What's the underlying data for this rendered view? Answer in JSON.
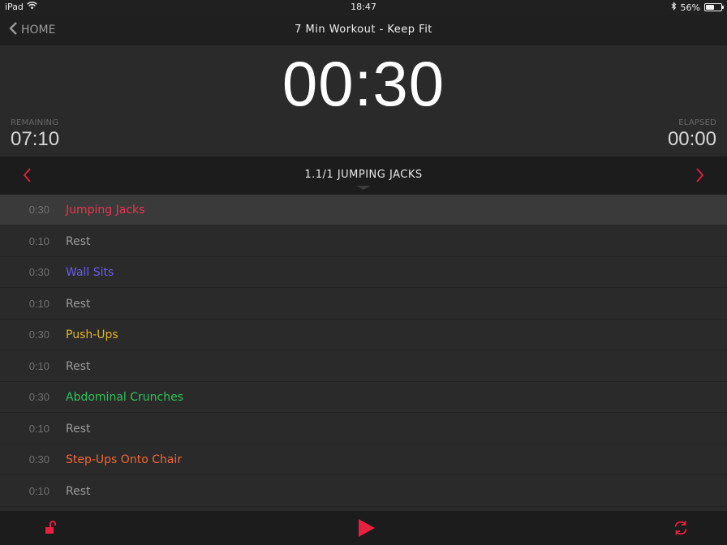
{
  "status_bar": {
    "device": "iPad",
    "time": "18:47",
    "battery_percent": "56%",
    "battery_level": 0.56
  },
  "nav": {
    "back_label": "HOME",
    "title": "7 Min Workout - Keep Fit"
  },
  "timer": {
    "current": "00:30",
    "remaining_label": "REMAINING",
    "remaining_value": "07:10",
    "elapsed_label": "ELAPSED",
    "elapsed_value": "00:00"
  },
  "current_exercise": {
    "title": "1.1/1 JUMPING JACKS"
  },
  "exercises": [
    {
      "time": "0:30",
      "name": "Jumping Jacks",
      "color": "#e8364f",
      "active": true
    },
    {
      "time": "0:10",
      "name": "Rest",
      "color": "#9a9a9a"
    },
    {
      "time": "0:30",
      "name": "Wall Sits",
      "color": "#6a5cf0"
    },
    {
      "time": "0:10",
      "name": "Rest",
      "color": "#9a9a9a"
    },
    {
      "time": "0:30",
      "name": "Push-Ups",
      "color": "#e3b52a"
    },
    {
      "time": "0:10",
      "name": "Rest",
      "color": "#9a9a9a"
    },
    {
      "time": "0:30",
      "name": "Abdominal Crunches",
      "color": "#2ec45a"
    },
    {
      "time": "0:10",
      "name": "Rest",
      "color": "#9a9a9a"
    },
    {
      "time": "0:30",
      "name": "Step-Ups Onto Chair",
      "color": "#f0683a"
    },
    {
      "time": "0:10",
      "name": "Rest",
      "color": "#9a9a9a"
    }
  ],
  "accent": "#e8203f",
  "icons": {
    "lock": "unlock-icon",
    "play": "play-icon",
    "repeat": "repeat-icon"
  }
}
